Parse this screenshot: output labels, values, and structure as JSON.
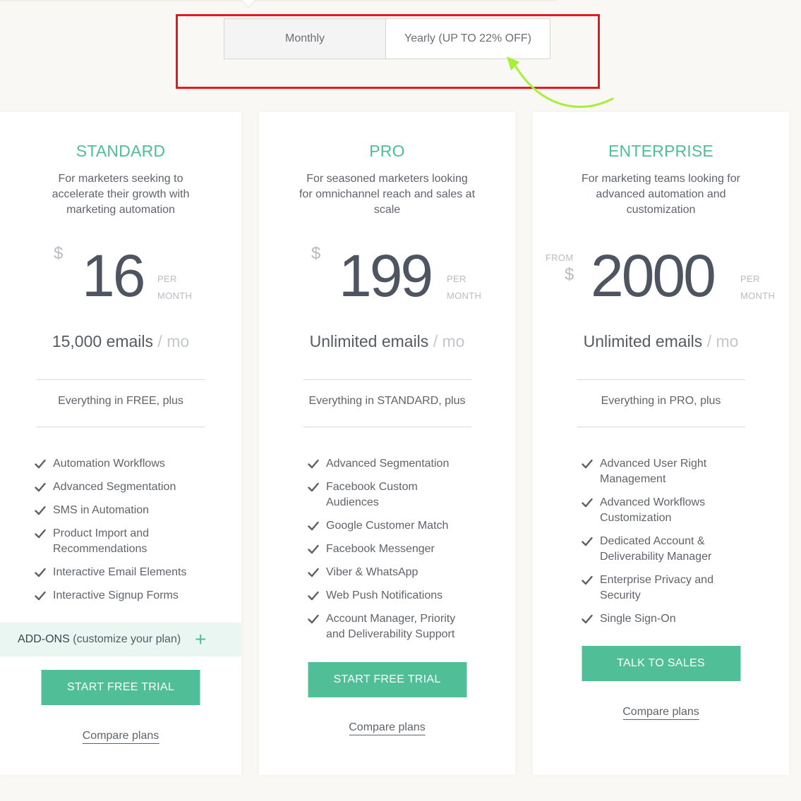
{
  "billing_toggle": {
    "monthly_label": "Monthly",
    "yearly_label": "Yearly (UP TO 22% OFF)"
  },
  "colors": {
    "accent": "#4cbf96",
    "button": "#50be97",
    "highlight_box": "#e8181c",
    "annotation_arrow": "#a6ef3a"
  },
  "plans": {
    "standard": {
      "name": "STANDARD",
      "description": "For marketers seeking to accelerate their growth with marketing automation",
      "currency": "$",
      "amount": "16",
      "per": "PER",
      "month": "MONTH",
      "emails": "15,000 emails",
      "emails_unit": "/ mo",
      "everything": "Everything in FREE, plus",
      "features": [
        "Automation Workflows",
        "Advanced Segmentation",
        "SMS in Automation",
        "Product Import and Recommendations",
        "Interactive Email Elements",
        "Interactive Signup Forms"
      ],
      "addons_bold": "ADD-ONS",
      "addons_text": "(customize your plan)",
      "addons_plus": "+",
      "cta": "START FREE TRIAL",
      "compare": "Compare plans"
    },
    "pro": {
      "name": "PRO",
      "description": "For seasoned marketers looking for omnichannel reach and sales at scale",
      "currency": "$",
      "amount": "199",
      "per": "PER",
      "month": "MONTH",
      "emails": "Unlimited emails",
      "emails_unit": "/ mo",
      "everything": "Everything in STANDARD, plus",
      "features": [
        "Advanced Segmentation",
        "Facebook Custom Audiences",
        "Google Customer Match",
        "Facebook Messenger",
        "Viber & WhatsApp",
        "Web Push Notifications",
        "Account Manager, Priority and Deliverability Support"
      ],
      "cta": "START FREE TRIAL",
      "compare": "Compare plans"
    },
    "enterprise": {
      "name": "ENTERPRISE",
      "description": "For marketing teams looking for advanced automation and customization",
      "from": "FROM",
      "currency": "$",
      "amount": "2000",
      "per": "PER",
      "month": "MONTH",
      "emails": "Unlimited emails",
      "emails_unit": "/ mo",
      "everything": "Everything in PRO, plus",
      "features": [
        "Advanced User Right Management",
        "Advanced Workflows Customization",
        "Dedicated Account & Deliverability Manager",
        "Enterprise Privacy and Security",
        "Single Sign-On"
      ],
      "cta": "TALK TO SALES",
      "compare": "Compare plans"
    }
  }
}
